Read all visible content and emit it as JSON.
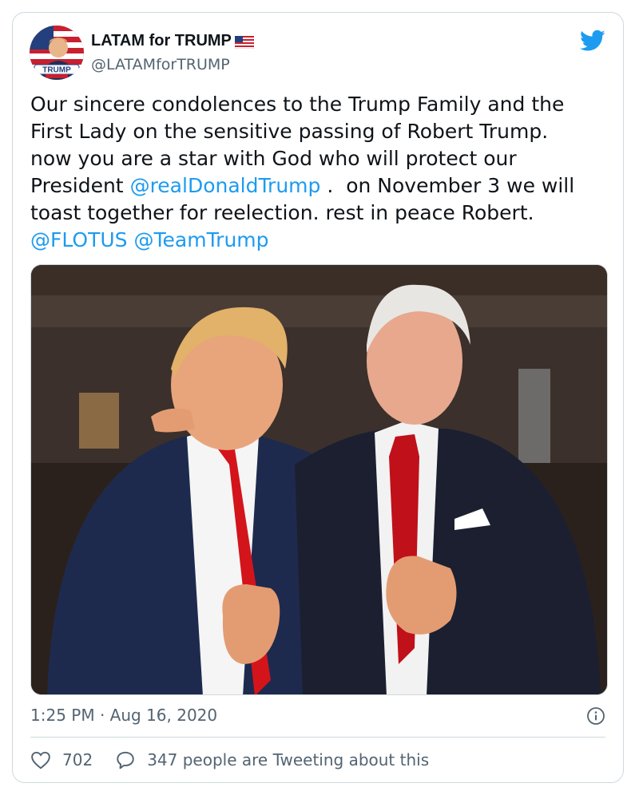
{
  "author": {
    "display_name": "LATAM for TRUMP",
    "handle": "@LATAMforTRUMP",
    "avatar_text": "TRUMP"
  },
  "tweet": {
    "line1": "Our sincere condolences to the Trump Family and the",
    "line2": "First Lady on the sensitive passing of Robert Trump.",
    "line3": "now you are a star with God who will protect our",
    "line4_prefix": "President ",
    "mention_1": "@realDonaldTrump",
    "line4_suffix": " .  on November 3 we will",
    "line5": "toast together for reelection. rest in peace Robert.",
    "mention_2": "@FLOTUS",
    "mention_3": "@TeamTrump"
  },
  "meta": {
    "timestamp": "1:25 PM · Aug 16, 2020"
  },
  "engagement": {
    "likes": "702",
    "tweeting_text": "347 people are Tweeting about this"
  },
  "icons": {
    "brand": "twitter-bird-icon",
    "info": "info-icon",
    "like": "heart-icon",
    "reply": "speech-bubble-icon",
    "flag": "us-flag-icon"
  },
  "colors": {
    "link": "#1d9bf0",
    "secondary_text": "#536471",
    "border": "#cfd9de",
    "twitter_blue": "#1d9bf0"
  }
}
